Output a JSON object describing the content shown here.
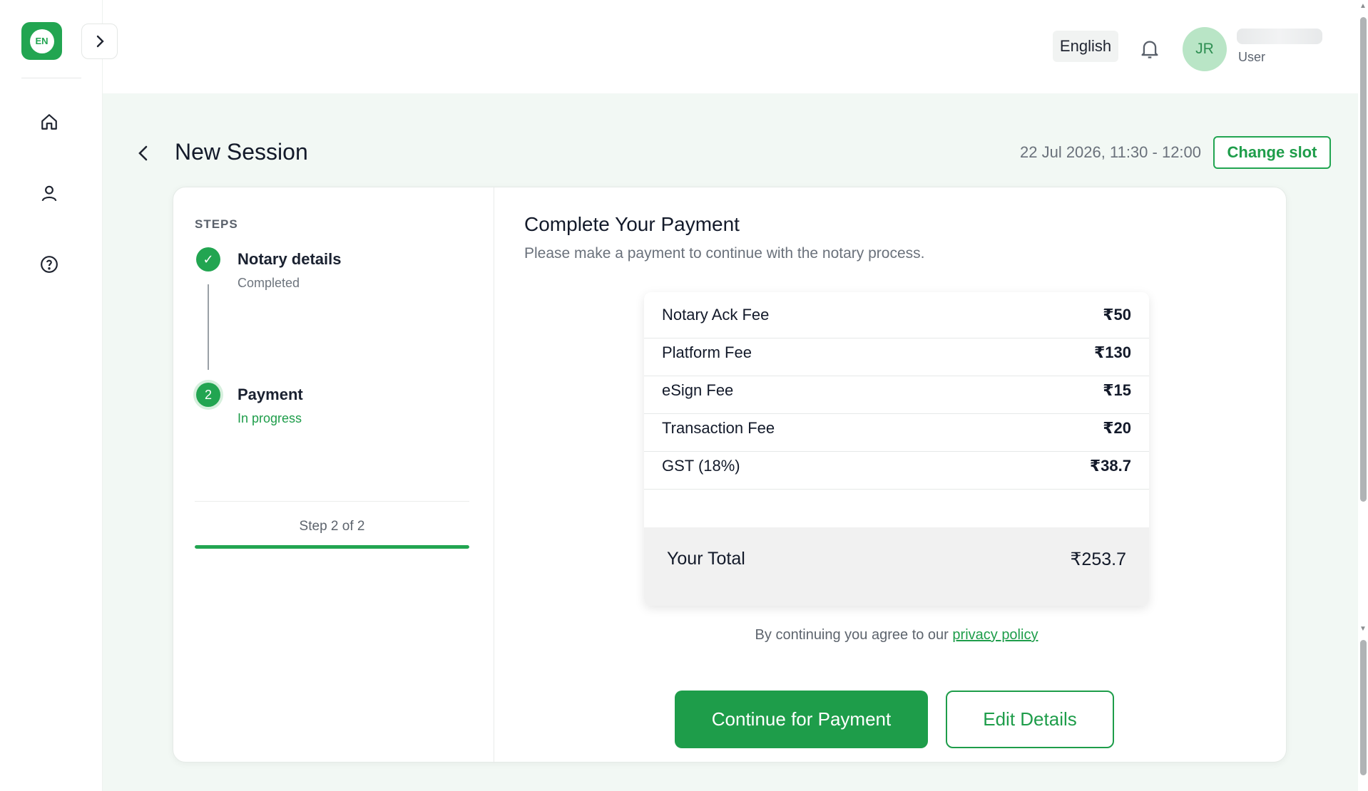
{
  "sidebar": {
    "logo_text": "EN",
    "nav": [
      "home-icon",
      "user-icon",
      "help-icon"
    ]
  },
  "header": {
    "language": "English",
    "avatar_initials": "JR",
    "user_role": "User"
  },
  "page": {
    "title": "New Session",
    "slot": "22 Jul 2026, 11:30 - 12:00",
    "change_slot_label": "Change slot"
  },
  "steps": {
    "heading": "STEPS",
    "items": [
      {
        "title": "Notary details",
        "status": "Completed",
        "marker": "✓"
      },
      {
        "title": "Payment",
        "status": "In progress",
        "marker": "2"
      }
    ],
    "counter": "Step 2 of 2",
    "progress": 1.0
  },
  "payment": {
    "title": "Complete Your Payment",
    "subtitle": "Please make a payment to continue with the notary process.",
    "fees": [
      {
        "name": "Notary Ack Fee",
        "amount": "₹50"
      },
      {
        "name": "Platform Fee",
        "amount": "₹130"
      },
      {
        "name": "eSign Fee",
        "amount": "₹15"
      },
      {
        "name": "Transaction Fee",
        "amount": "₹20"
      },
      {
        "name": "GST (18%)",
        "amount": "₹38.7"
      }
    ],
    "total_label": "Your Total",
    "total_amount": "₹253.7",
    "agree_text": "By continuing you agree to our ",
    "privacy_link": "privacy policy",
    "continue_label": "Continue for Payment",
    "edit_label": "Edit Details"
  },
  "colors": {
    "accent": "#22a551",
    "background": "#f2f8f4"
  }
}
